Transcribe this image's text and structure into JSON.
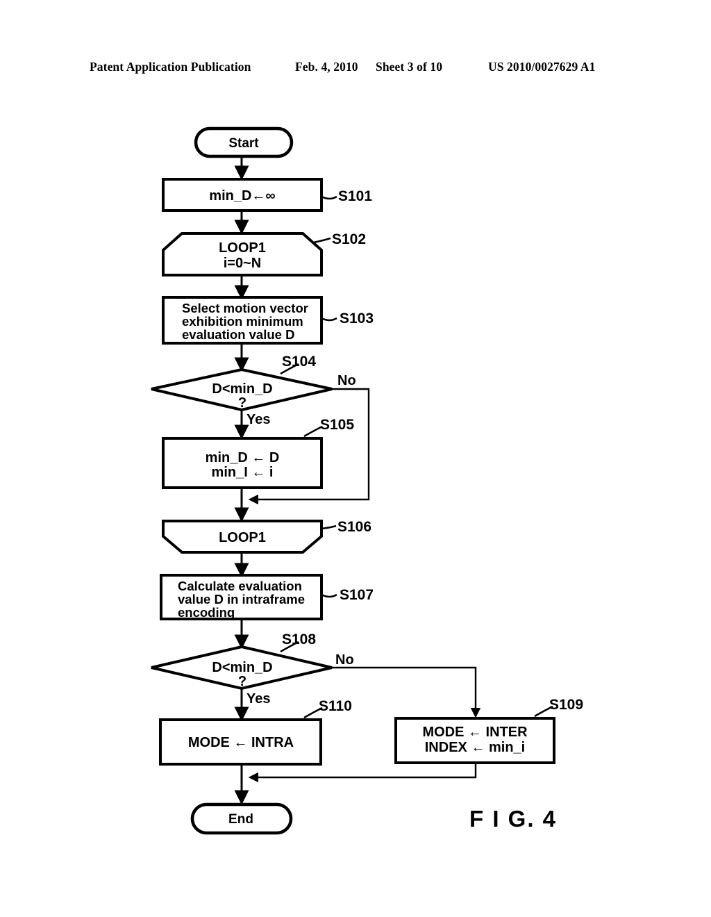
{
  "header": {
    "publication": "Patent Application Publication",
    "date": "Feb. 4, 2010",
    "sheet": "Sheet 3 of 10",
    "patent_number": "US 2010/0027629 A1"
  },
  "figure": {
    "caption": "F I G. 4"
  },
  "flowchart": {
    "nodes": {
      "start": {
        "id": "start",
        "type": "terminal",
        "label": "Start"
      },
      "s101": {
        "id": "S101",
        "type": "process",
        "step": "S101",
        "line1": "min_D←∞"
      },
      "s102": {
        "id": "S102",
        "type": "loop-start",
        "step": "S102",
        "line1": "LOOP1",
        "line2": "i=0~N"
      },
      "s103": {
        "id": "S103",
        "type": "process",
        "step": "S103",
        "line1": "Select motion vector",
        "line2": "exhibition minimum",
        "line3": "evaluation value D"
      },
      "s104": {
        "id": "S104",
        "type": "decision",
        "step": "S104",
        "line1": "D<min_D",
        "line2": "?",
        "yes": "Yes",
        "no": "No"
      },
      "s105": {
        "id": "S105",
        "type": "process",
        "step": "S105",
        "line1": "min_D ← D",
        "line2": "min_I ← i"
      },
      "s106": {
        "id": "S106",
        "type": "loop-end",
        "step": "S106",
        "line1": "LOOP1"
      },
      "s107": {
        "id": "S107",
        "type": "process",
        "step": "S107",
        "line1": "Calculate evaluation",
        "line2": "value D in intraframe",
        "line3": "encoding"
      },
      "s108": {
        "id": "S108",
        "type": "decision",
        "step": "S108",
        "line1": "D<min_D",
        "line2": "?",
        "yes": "Yes",
        "no": "No"
      },
      "s109": {
        "id": "S109",
        "type": "process",
        "step": "S109",
        "line1": "MODE ← INTER",
        "line2": "INDEX ← min_i"
      },
      "s110": {
        "id": "S110",
        "type": "process",
        "step": "S110",
        "line1": "MODE ← INTRA"
      },
      "end": {
        "id": "end",
        "type": "terminal",
        "label": "End"
      }
    },
    "colors": {
      "stroke": "#000000",
      "fill": "#ffffff",
      "page_background": "#ffffff"
    }
  }
}
